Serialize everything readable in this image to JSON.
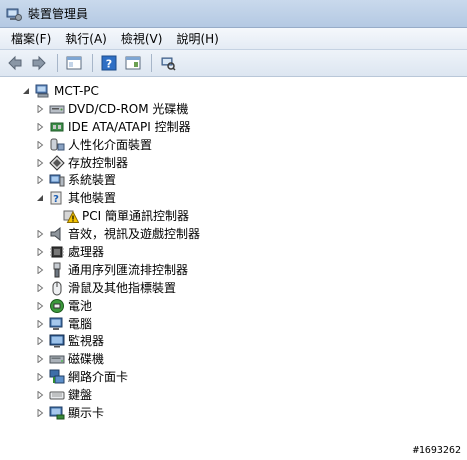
{
  "window": {
    "title": "裝置管理員",
    "icon": "device-manager-icon"
  },
  "menu": {
    "items": [
      "檔案(F)",
      "執行(A)",
      "檢視(V)",
      "說明(H)"
    ]
  },
  "toolbar": {
    "icons": [
      "back-arrow-icon",
      "forward-arrow-icon",
      "console-tree-icon",
      "help-icon",
      "properties-icon",
      "scan-hardware-icon"
    ]
  },
  "tree": {
    "root": "MCT-PC",
    "categories": [
      {
        "label": "DVD/CD-ROM 光碟機",
        "icon": "dvd-drive-icon"
      },
      {
        "label": "IDE ATA/ATAPI 控制器",
        "icon": "ide-controller-icon"
      },
      {
        "label": "人性化介面裝置",
        "icon": "hid-icon"
      },
      {
        "label": "存放控制器",
        "icon": "storage-controller-icon"
      },
      {
        "label": "系統裝置",
        "icon": "system-device-icon"
      },
      {
        "label": "其他裝置",
        "icon": "other-devices-icon"
      },
      {
        "label": "PCI 簡單通訊控制器",
        "icon": "warning-icon"
      },
      {
        "label": "音效，視訊及遊戲控制器",
        "icon": "speaker-icon"
      },
      {
        "label": "處理器",
        "icon": "processor-icon"
      },
      {
        "label": "通用序列匯流排控制器",
        "icon": "usb-controller-icon"
      },
      {
        "label": "滑鼠及其他指標裝置",
        "icon": "mouse-icon"
      },
      {
        "label": "電池",
        "icon": "battery-icon"
      },
      {
        "label": "電腦",
        "icon": "computer-icon"
      },
      {
        "label": "監視器",
        "icon": "monitor-icon"
      },
      {
        "label": "磁碟機",
        "icon": "disk-drive-icon"
      },
      {
        "label": "網路介面卡",
        "icon": "network-adapter-icon"
      },
      {
        "label": "鍵盤",
        "icon": "keyboard-icon"
      },
      {
        "label": "顯示卡",
        "icon": "display-adapter-icon"
      }
    ]
  },
  "watermark": "#1693262"
}
